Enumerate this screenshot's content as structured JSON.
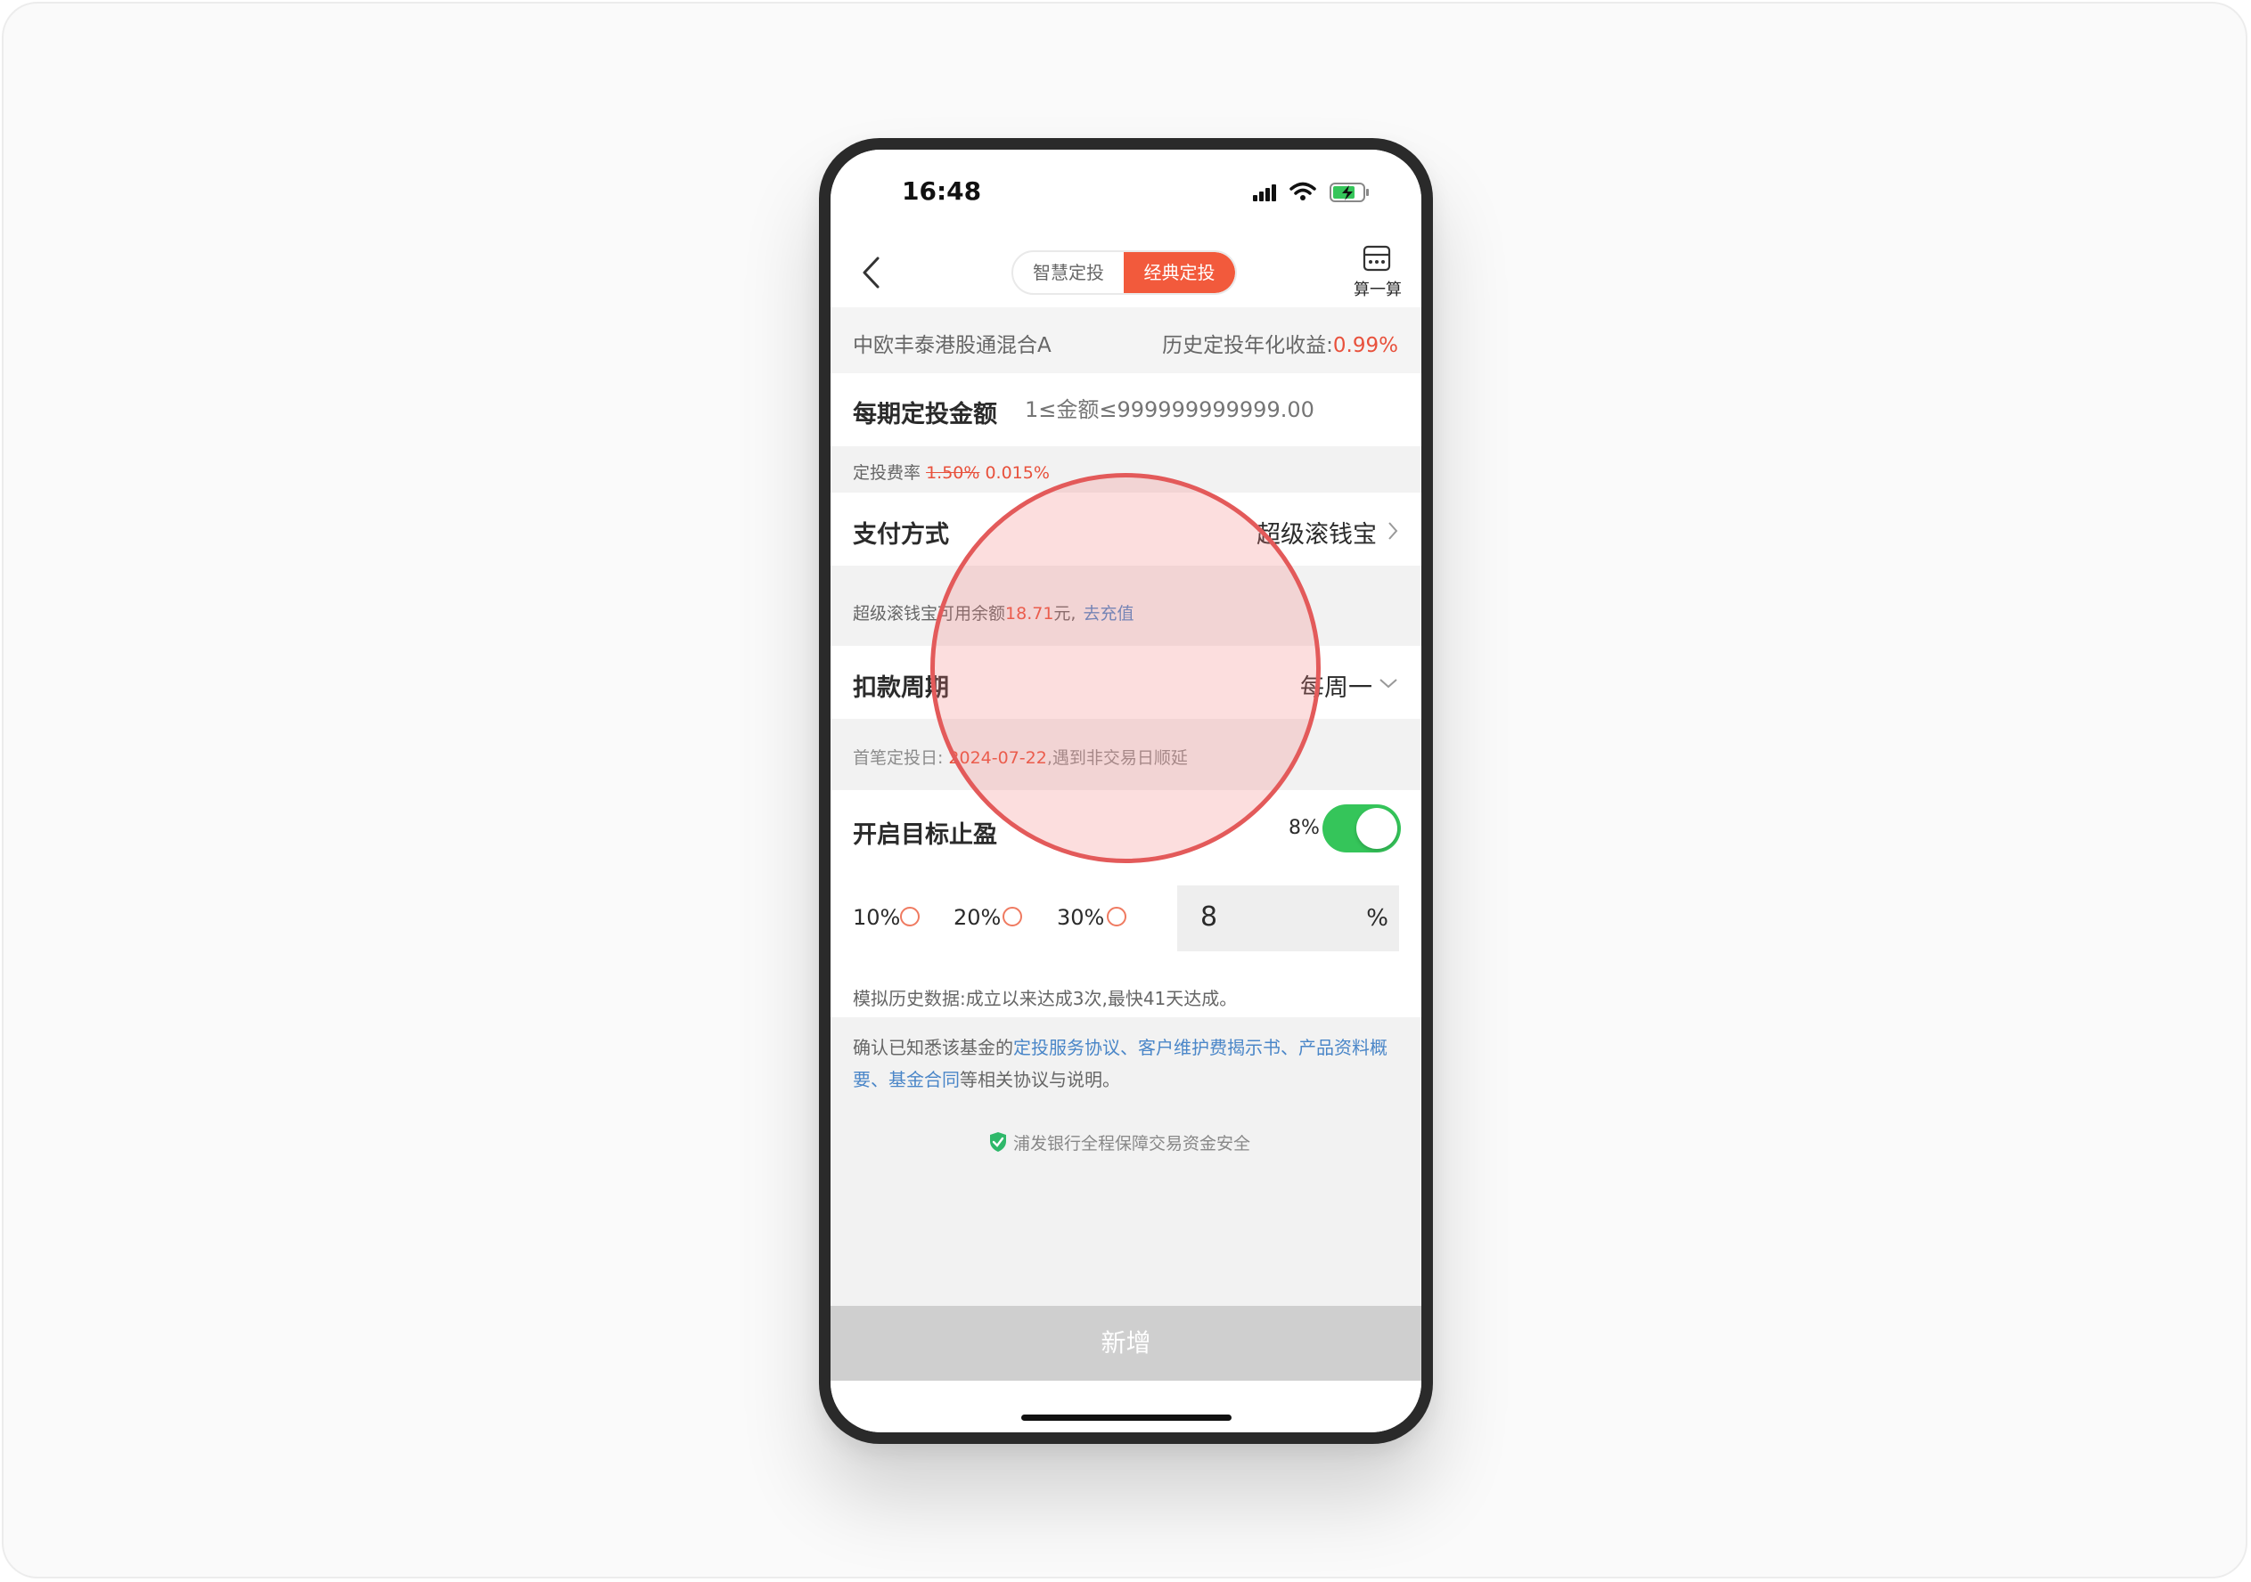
{
  "status_bar": {
    "time": "16:48"
  },
  "header": {
    "tabs": [
      {
        "label": "智慧定投",
        "active": false
      },
      {
        "label": "经典定投",
        "active": true
      }
    ],
    "calculator_label": "算一算"
  },
  "fund": {
    "name": "中欧丰泰港股通混合A",
    "return_label": "历史定投年化收益:",
    "return_value": "0.99%"
  },
  "amount": {
    "label": "每期定投金额",
    "placeholder": "1≤金额≤999999999999.00"
  },
  "fee": {
    "label": "定投费率",
    "original": "1.50%",
    "discounted": "0.015%"
  },
  "payment": {
    "label": "支付方式",
    "value": "超级滚钱宝",
    "balance_prefix": "超级滚钱宝可用余额",
    "balance_amount": "18.71",
    "balance_suffix": "元,",
    "recharge_link": "去充值"
  },
  "cycle": {
    "label": "扣款周期",
    "value": "每周一",
    "first_date_prefix": "首笔定投日:",
    "first_date": "2024-07-22",
    "first_date_suffix": ",遇到非交易日顺延"
  },
  "take_profit": {
    "label": "开启目标止盈",
    "value": "8%",
    "enabled": true,
    "options": [
      "10%",
      "20%",
      "30%"
    ],
    "input_value": "8",
    "unit": "%"
  },
  "simulation": "模拟历史数据:成立以来达成3次,最快41天达成。",
  "agreement": {
    "prefix": "确认已知悉该基金的",
    "links": [
      "定投服务协议",
      "客户维护费揭示书",
      "产品资料概要",
      "基金合同"
    ],
    "separator": "、",
    "suffix": "等相关协议与说明。"
  },
  "security_note": "浦发银行全程保障交易资金安全",
  "submit_label": "新增",
  "colors": {
    "accent": "#f25a3c",
    "toggle_on": "#35c55a",
    "link": "#4a86c8",
    "disabled_button": "#cfcfcf"
  }
}
